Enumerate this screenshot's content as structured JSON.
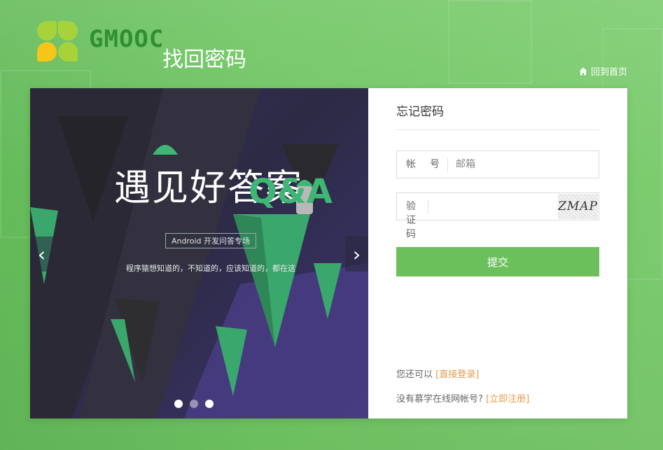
{
  "header": {
    "brand": "GMOOC",
    "page_title": "找回密码",
    "home_link": "回到首页"
  },
  "carousel": {
    "heading": "遇见好答案",
    "qa_text": "Q&A",
    "subtitle": "Android 开发问答专场",
    "description": "程序猿想知道的，不知道的，应该知道的，都在这",
    "prev_arrow": "‹",
    "next_arrow": "›",
    "active_slide": 2,
    "slide_count": 3
  },
  "form": {
    "title": "忘记密码",
    "account_label": "帐　号",
    "account_placeholder": "邮箱",
    "captcha_label": "验证码",
    "captcha_value": "",
    "captcha_image_text": "ZMAP",
    "submit_label": "提交",
    "login_hint_prefix": "您还可以",
    "login_link": "[直接登录]",
    "register_hint_prefix": "没有慕学在线网帐号?",
    "register_link": "[立即注册]"
  },
  "colors": {
    "background_green": "#6cc160",
    "submit_green": "#6cc05b",
    "link_orange": "#e99b4a",
    "brand_green": "#2f8f33"
  },
  "icons": {
    "home": "home-icon",
    "logo": "four-leaf-logo-icon"
  }
}
